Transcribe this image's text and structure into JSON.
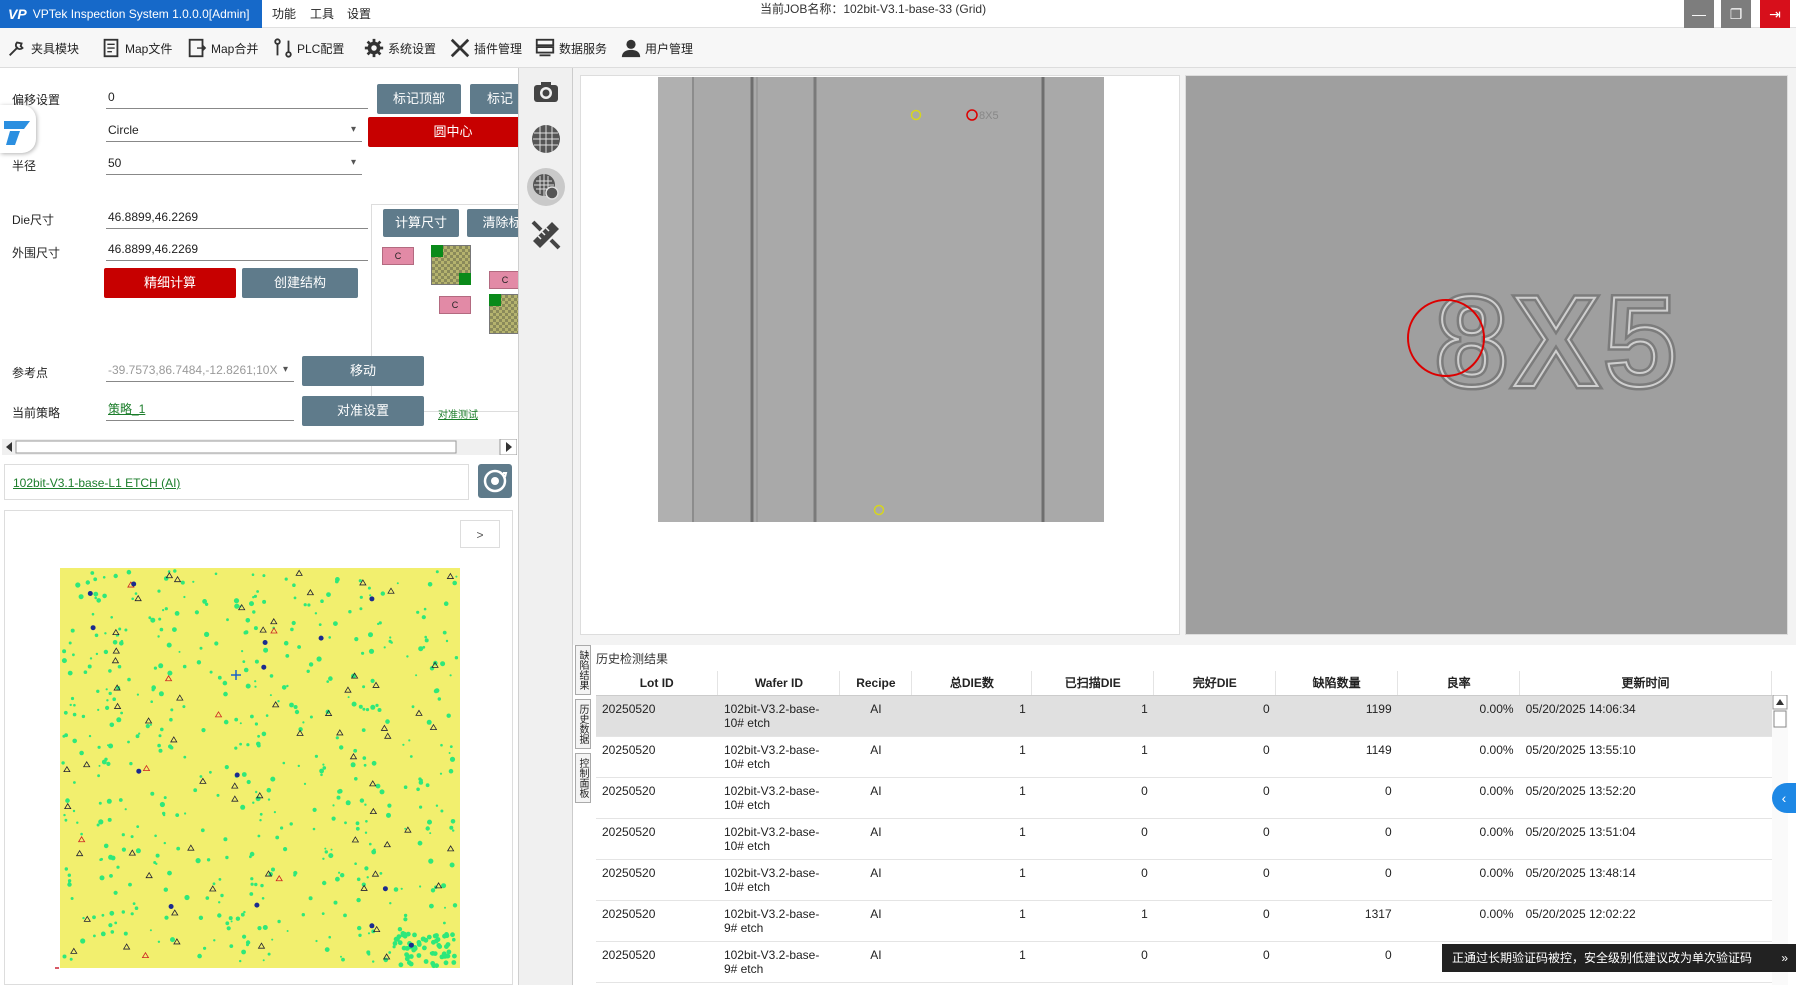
{
  "titlebar": {
    "app": "VPTek Inspection System 1.0.0.0[Admin]",
    "menus": [
      "功能",
      "工具",
      "设置"
    ],
    "job_title": "当前JOB名称：102bit-V3.1-base-33 (Grid)"
  },
  "toolbar": {
    "items": [
      "夹具模块",
      "Map文件",
      "Map合并",
      "PLC配置",
      "系统设置",
      "插件管理",
      "数据服务",
      "用户管理"
    ]
  },
  "left": {
    "offset_label": "偏移设置",
    "offset_value": "0",
    "btn_mark_top": "标记顶部",
    "btn_mark_2": "标记",
    "shape_value": "Circle",
    "btn_center": "圆中心",
    "radius_label": "半径",
    "radius_value": "50",
    "btn_calc_size": "计算尺寸",
    "btn_clear": "清除标",
    "die_label": "Die尺寸",
    "die_value": "46.8899,46.2269",
    "outer_label": "外围尺寸",
    "outer_value": "46.8899,46.2269",
    "btn_fine_calc": "精细计算",
    "btn_create_struct": "创建结构",
    "ref_label": "参考点",
    "ref_value": "-39.7573,86.7484,-12.8261;10X",
    "btn_move": "移动",
    "strategy_label": "当前策略",
    "strategy_value": "策略_1",
    "btn_align_setup": "对准设置",
    "align_test_link": "对准测试",
    "diagram_c": "C",
    "job_name": "102bit-V3.1-base-L1 ETCH (AI)",
    "map_next": ">"
  },
  "images": {
    "pane1_label": "8X5",
    "pane2_label": "8X5"
  },
  "history": {
    "title": "历史检测结果",
    "tabs": [
      "缺陷结果",
      "历史数据",
      "控制面板"
    ],
    "columns": [
      "Lot ID",
      "Wafer ID",
      "Recipe",
      "总DIE数",
      "已扫描DIE",
      "完好DIE",
      "缺陷数量",
      "良率",
      "更新时间"
    ],
    "rows": [
      {
        "lot": "20250520",
        "wafer": "102bit-V3.2-base-10# etch",
        "recipe": "AI",
        "total": "1",
        "scanned": "1",
        "good": "0",
        "defects": "1199",
        "yield": "0.00%",
        "time": "05/20/2025 14:06:34"
      },
      {
        "lot": "20250520",
        "wafer": "102bit-V3.2-base-10# etch",
        "recipe": "AI",
        "total": "1",
        "scanned": "1",
        "good": "0",
        "defects": "1149",
        "yield": "0.00%",
        "time": "05/20/2025 13:55:10"
      },
      {
        "lot": "20250520",
        "wafer": "102bit-V3.2-base-10# etch",
        "recipe": "AI",
        "total": "1",
        "scanned": "0",
        "good": "0",
        "defects": "0",
        "yield": "0.00%",
        "time": "05/20/2025 13:52:20"
      },
      {
        "lot": "20250520",
        "wafer": "102bit-V3.2-base-10# etch",
        "recipe": "AI",
        "total": "1",
        "scanned": "0",
        "good": "0",
        "defects": "0",
        "yield": "0.00%",
        "time": "05/20/2025 13:51:04"
      },
      {
        "lot": "20250520",
        "wafer": "102bit-V3.2-base-10# etch",
        "recipe": "AI",
        "total": "1",
        "scanned": "0",
        "good": "0",
        "defects": "0",
        "yield": "0.00%",
        "time": "05/20/2025 13:48:14"
      },
      {
        "lot": "20250520",
        "wafer": "102bit-V3.2-base-9# etch",
        "recipe": "AI",
        "total": "1",
        "scanned": "1",
        "good": "0",
        "defects": "1317",
        "yield": "0.00%",
        "time": "05/20/2025 12:02:22"
      },
      {
        "lot": "20250520",
        "wafer": "102bit-V3.2-base-9# etch",
        "recipe": "AI",
        "total": "1",
        "scanned": "0",
        "good": "0",
        "defects": "0",
        "yield": "",
        "time": ""
      }
    ]
  },
  "toast": {
    "text": "正通过长期验证码被控，安全级别低建议改为单次验证码",
    "arrow": "»"
  },
  "colors": {
    "accent": "#1669c9",
    "danger": "#c70000",
    "button": "#5f7b8b",
    "map_bg": "#f2ef6e",
    "map_dot": "#2ee87a"
  }
}
